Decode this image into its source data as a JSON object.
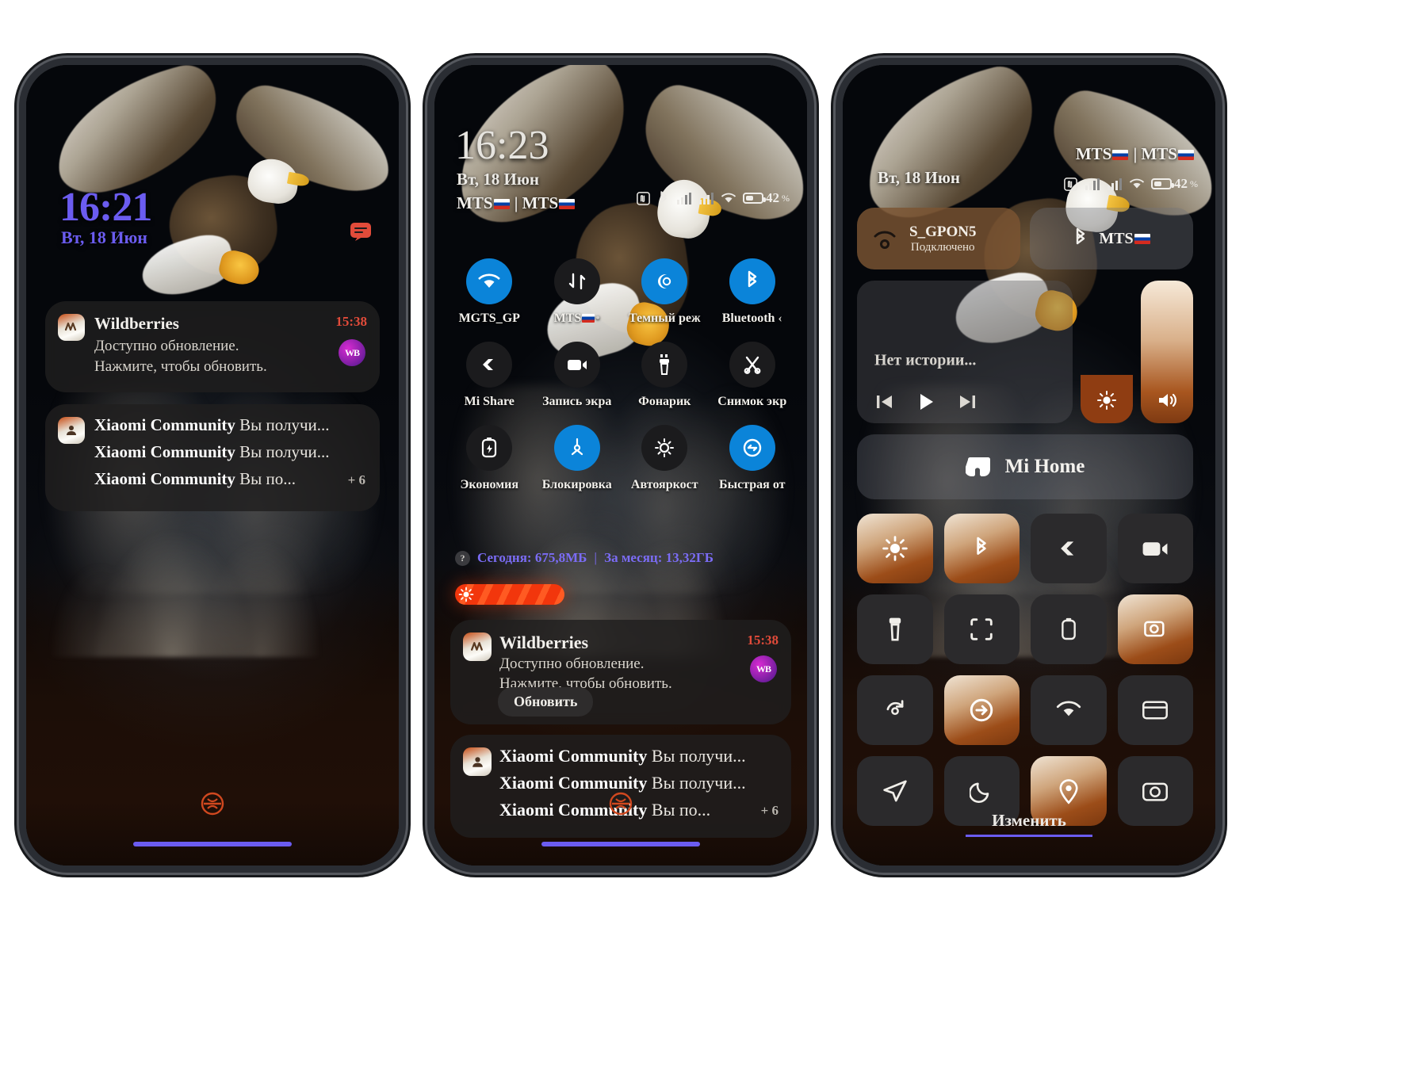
{
  "phone1": {
    "clock": "16:21",
    "date": "Вт, 18 Июн",
    "notifications": [
      {
        "app": "Wildberries",
        "time": "15:38",
        "line1": "Доступно обновление.",
        "line2": "Нажмите, чтобы обновить.",
        "badge": "WB"
      }
    ],
    "group": {
      "rows": [
        {
          "app": "Xiaomi Community",
          "text": "Вы получи..."
        },
        {
          "app": "Xiaomi Community",
          "text": "Вы получи..."
        },
        {
          "app": "Xiaomi Community",
          "text": "Вы по..."
        }
      ],
      "more": "+ 6"
    }
  },
  "phone2": {
    "clock": "16:23",
    "date": "Вт, 18 Июн",
    "carrier1": "MTS",
    "carrier2": "MTS",
    "carrier_sep": "|",
    "battery": "42",
    "battery_pct_sign": "%",
    "tiles": [
      {
        "label": "MGTS_GP",
        "icon": "wifi-icon",
        "on": true
      },
      {
        "label": "MTS",
        "icon": "mobile-data-icon",
        "on": false,
        "suffix": "•"
      },
      {
        "label": "Темный реж",
        "icon": "dark-mode-icon",
        "on": true
      },
      {
        "label": "Bluetooth",
        "icon": "bluetooth-icon",
        "on": true,
        "suffix": "‹"
      },
      {
        "label": "Mi Share",
        "icon": "mi-share-icon",
        "on": false
      },
      {
        "label": "Запись экра",
        "icon": "screen-record-icon",
        "on": false
      },
      {
        "label": "Фонарик",
        "icon": "flashlight-icon",
        "on": false
      },
      {
        "label": "Снимок экр",
        "icon": "screenshot-icon",
        "on": false
      },
      {
        "label": "Экономия",
        "icon": "battery-saver-icon",
        "on": false
      },
      {
        "label": "Блокировка",
        "icon": "rotation-lock-icon",
        "on": true
      },
      {
        "label": "Автояркост",
        "icon": "auto-brightness-icon",
        "on": false
      },
      {
        "label": "Быстрая от",
        "icon": "quick-reply-icon",
        "on": true
      }
    ],
    "usage": {
      "today_label": "Сегодня: 675,8МБ",
      "separator": "|",
      "month_label": "За месяц: 13,32ГБ",
      "help": "?"
    },
    "notifications": [
      {
        "app": "Wildberries",
        "time": "15:38",
        "line1": "Доступно обновление.",
        "line2": "Нажмите, чтобы обновить.",
        "button": "Обновить",
        "badge": "WB"
      }
    ],
    "group": {
      "rows": [
        {
          "app": "Xiaomi Community",
          "text": "Вы получи..."
        },
        {
          "app": "Xiaomi Community",
          "text": "Вы получи..."
        },
        {
          "app": "Xiaomi Community",
          "text": "Вы по..."
        }
      ],
      "more": "+ 6"
    }
  },
  "phone3": {
    "date": "Вт, 18 Июн",
    "carrier1": "MTS",
    "carrier2": "MTS",
    "carrier_sep": "|",
    "battery": "42",
    "battery_pct_sign": "%",
    "wifi_card": {
      "name": "S_GPON5",
      "status": "Подключено"
    },
    "bt_card": {
      "name": "MTS"
    },
    "media_card": {
      "empty_text": "Нет истории..."
    },
    "mihome_card": {
      "label": "Mi Home"
    },
    "tiles": [
      {
        "icon": "auto-brightness-icon",
        "style": "warm"
      },
      {
        "icon": "bluetooth-icon",
        "style": "warm"
      },
      {
        "icon": "mi-share-icon",
        "style": "dark"
      },
      {
        "icon": "screen-record-icon",
        "style": "dark"
      },
      {
        "icon": "flashlight-icon",
        "style": "dark"
      },
      {
        "icon": "screenshot-icon",
        "style": "dark"
      },
      {
        "icon": "battery-saver-icon",
        "style": "dark"
      },
      {
        "icon": "quick-reply-icon",
        "style": "warm"
      },
      {
        "icon": "rotation-lock-icon",
        "style": "dark"
      },
      {
        "icon": "data-saver-icon",
        "style": "warm"
      },
      {
        "icon": "wifi-icon",
        "style": "dark"
      },
      {
        "icon": "wallet-icon",
        "style": "dark"
      }
    ],
    "edit_label": "Изменить"
  }
}
